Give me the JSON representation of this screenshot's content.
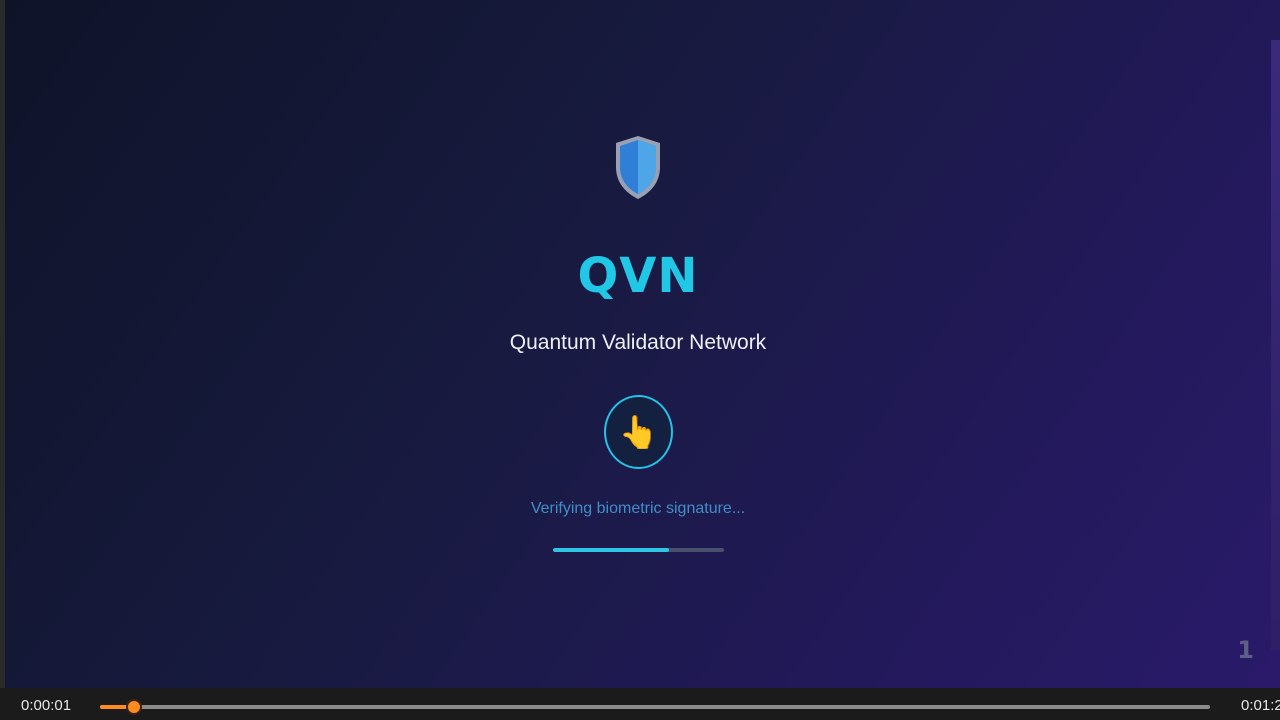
{
  "app": {
    "logo_icon": "shield-icon",
    "brand": "QVN",
    "subtitle": "Quantum Validator Network",
    "fingerprint_icon": "pointing-hand-icon",
    "fingerprint_glyph": "👆",
    "status_text": "Verifying biometric signature...",
    "progress_fraction": 0.68,
    "slide_number": "1"
  },
  "player": {
    "current_time": "0:00:01",
    "total_time": "0:01:2",
    "seek_fraction": 0.031
  },
  "colors": {
    "accent": "#20c8e6",
    "status": "#3f8fc6",
    "seek": "#ff8a1f"
  }
}
